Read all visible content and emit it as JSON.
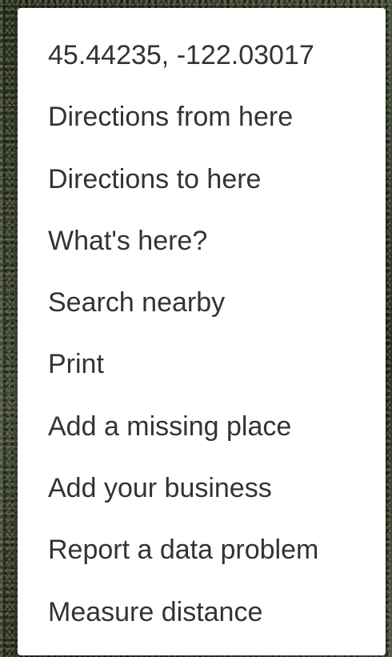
{
  "context_menu": {
    "coordinates": "45.44235, -122.03017",
    "items": [
      {
        "label": "Directions from here"
      },
      {
        "label": "Directions to here"
      },
      {
        "label": "What's here?"
      },
      {
        "label": "Search nearby"
      },
      {
        "label": "Print"
      },
      {
        "label": "Add a missing place"
      },
      {
        "label": "Add your business"
      },
      {
        "label": "Report a data problem"
      },
      {
        "label": "Measure distance"
      }
    ]
  },
  "colors": {
    "menu_background": "#ffffff",
    "text": "#333333",
    "map_background": "#34392c"
  }
}
